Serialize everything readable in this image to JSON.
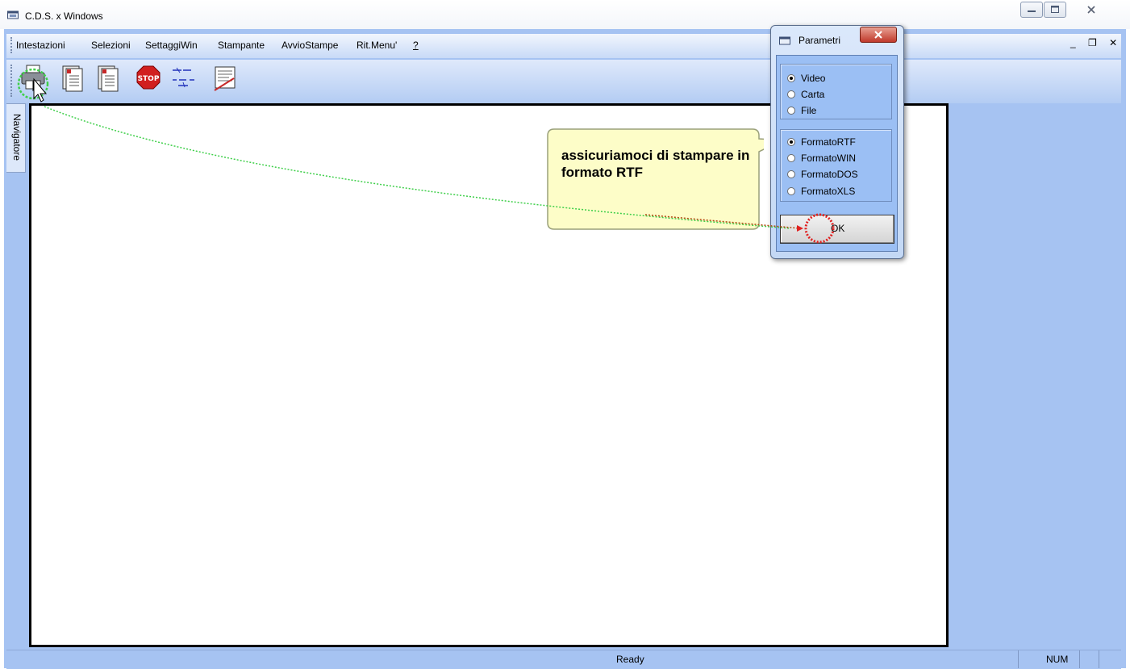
{
  "window": {
    "title": "C.D.S. x Windows",
    "app_icon": "printer-window-icon"
  },
  "menubar": {
    "items": [
      "Intestazioni",
      "Selezioni",
      "SettaggiWin",
      "Stampante",
      "AvvioStampe",
      "Rit.Menu'",
      "?"
    ],
    "mdi_controls": "_ ❐ ✕"
  },
  "toolbar": {
    "icons": [
      "printer-icon",
      "document-1-icon",
      "document-2-icon",
      "stop-icon",
      "formula-icon",
      "script-icon"
    ],
    "stop_label": "STOP"
  },
  "navigator": {
    "tab_label": "Navigatore"
  },
  "dialog": {
    "title": "Parametri",
    "output_group": [
      {
        "label": "Video",
        "selected": true
      },
      {
        "label": "Carta",
        "selected": false
      },
      {
        "label": "File",
        "selected": false
      }
    ],
    "format_group": [
      {
        "label": "FormatoRTF",
        "selected": true
      },
      {
        "label": "FormatoWIN",
        "selected": false
      },
      {
        "label": "FormatoDOS",
        "selected": false
      },
      {
        "label": "FormatoXLS",
        "selected": false
      }
    ],
    "ok_label": "OK"
  },
  "callout": {
    "text": "assicuriamoci di stampare in formato RTF",
    "fill": "#fdfdc8"
  },
  "statusbar": {
    "ready": "Ready",
    "num": "NUM"
  },
  "colors": {
    "frame": "#a6c3f2",
    "dialog_client": "#9bbff4",
    "highlight_green": "#3fcf4a",
    "highlight_red": "#e02020"
  }
}
